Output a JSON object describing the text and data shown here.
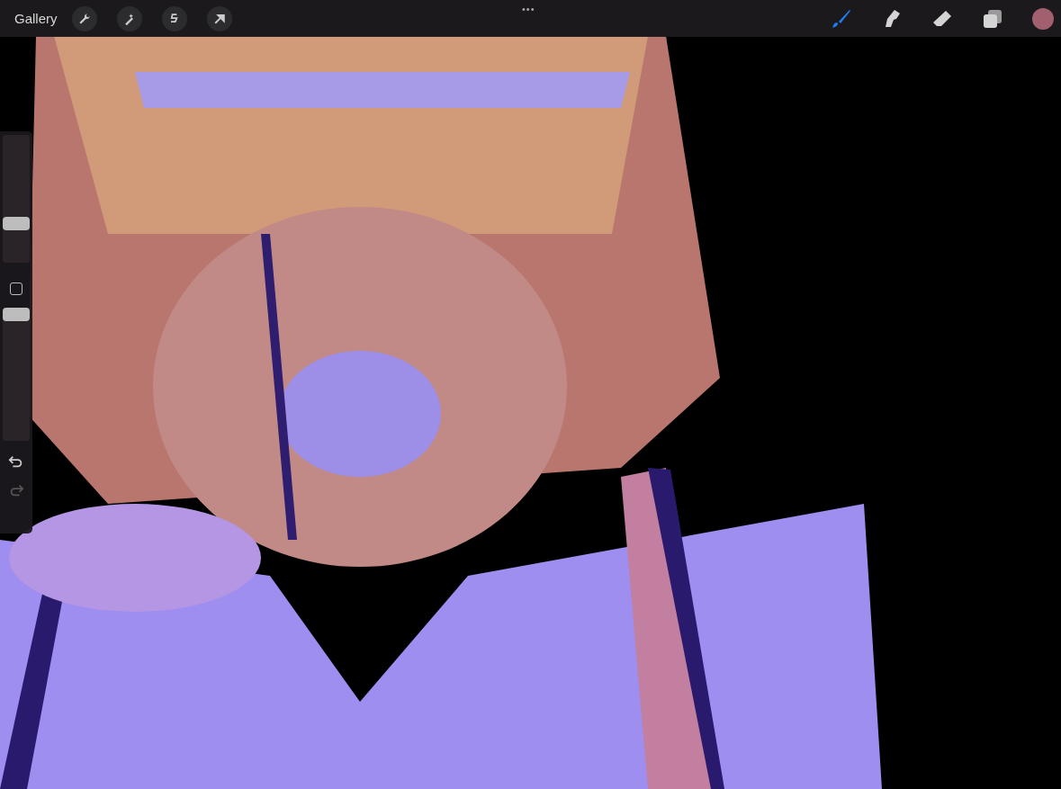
{
  "top_bar": {
    "gallery": "Gallery",
    "more": "•••",
    "actions": [
      {
        "kind": "wrench"
      },
      {
        "kind": "wand"
      },
      {
        "kind": "selection"
      },
      {
        "kind": "transform"
      }
    ],
    "tools": [
      {
        "kind": "brush",
        "selected": true
      },
      {
        "kind": "smudge",
        "selected": false
      },
      {
        "kind": "eraser",
        "selected": false
      },
      {
        "kind": "layers",
        "selected": false
      },
      {
        "kind": "color",
        "color": "#a2606f",
        "selected": false
      }
    ]
  },
  "sidebar": {
    "size_slider": {
      "level": 0.31
    },
    "opacity_slider": {
      "level": 0.95
    },
    "undo": {
      "disabled": false
    },
    "redo": {
      "disabled": true
    }
  }
}
